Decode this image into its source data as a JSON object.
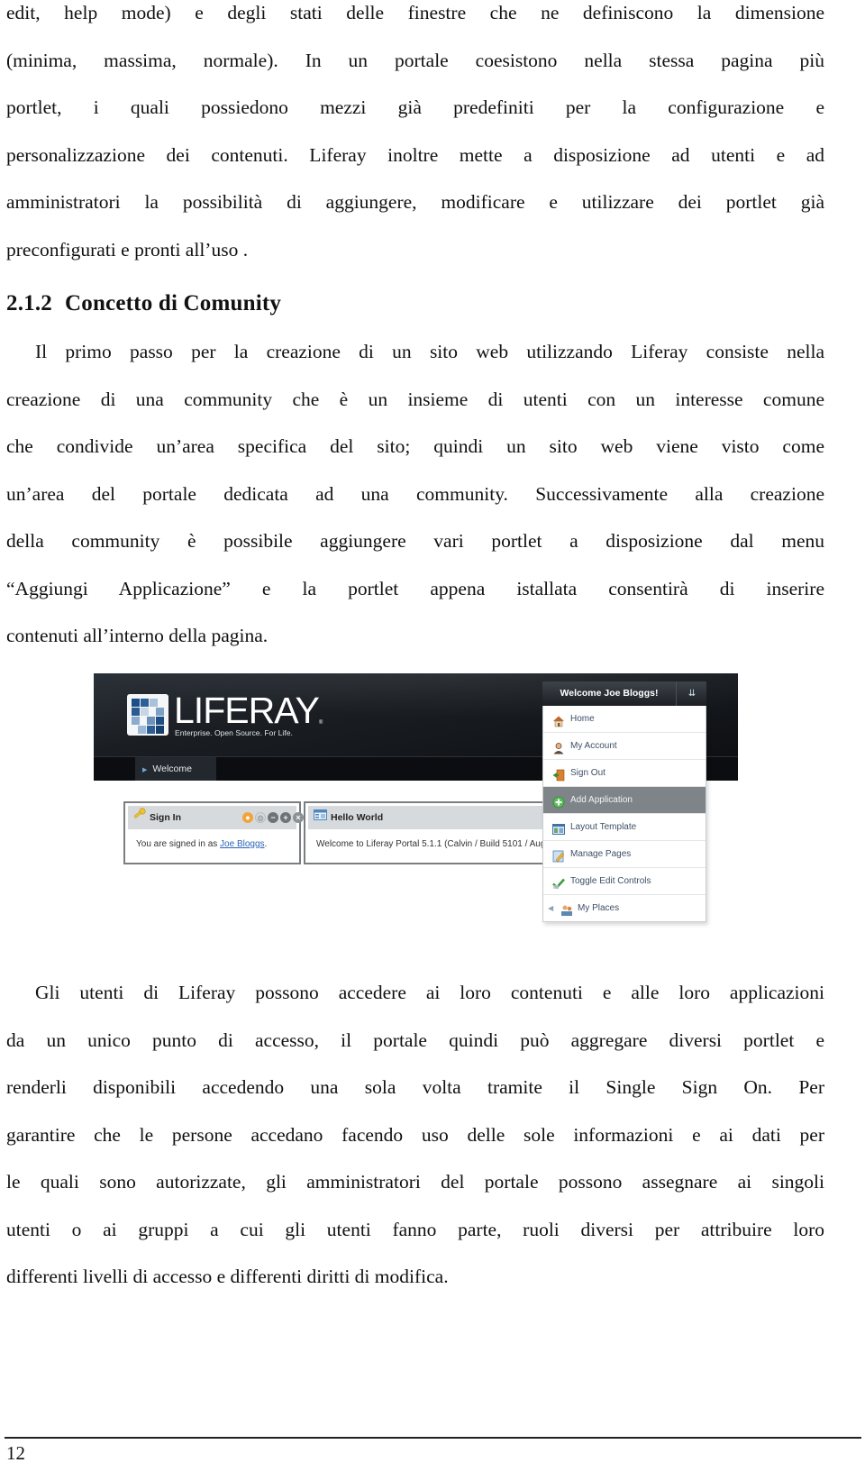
{
  "paragraph_1": {
    "lines": [
      "edit, help mode) e degli stati delle finestre che ne definiscono la dimensione",
      "(minima, massima, normale). In un portale coesistono nella stessa pagina più",
      "portlet, i quali possiedono mezzi già predefiniti per la configurazione e",
      "personalizzazione dei contenuti. Liferay inoltre mette a disposizione ad utenti e ad",
      "amministratori la possibilità di aggiungere, modificare e utilizzare dei portlet già",
      "preconfigurati e pronti all’uso ."
    ]
  },
  "section": {
    "number": "2.1.2",
    "title": "Concetto di Comunity"
  },
  "paragraph_2": {
    "lines": [
      "Il primo passo per la creazione di un sito web utilizzando Liferay consiste nella",
      "creazione di una community che è un insieme di utenti con un interesse comune",
      "che condivide un’area specifica del sito; quindi un sito web viene visto  come",
      "un’area del portale dedicata ad una community. Successivamente alla creazione",
      "della community è possibile aggiungere vari portlet a disposizione dal menu",
      "“Aggiungi Applicazione” e la portlet appena istallata consentirà di inserire",
      "contenuti all’interno della pagina."
    ]
  },
  "figure": {
    "logo": {
      "wordmark": "LIFERAY",
      "trademark": "®",
      "tagline": "Enterprise. Open Source. For Life."
    },
    "nav": {
      "current_page": "Welcome"
    },
    "dock": {
      "title": "Welcome Joe Bloggs!",
      "toggle_icon": "double-chevron-down-icon",
      "menu": [
        {
          "label": "Home",
          "icon": "home-icon",
          "active": false
        },
        {
          "label": "My Account",
          "icon": "user-icon",
          "active": false
        },
        {
          "label": "Sign Out",
          "icon": "sign-out-icon",
          "active": false
        },
        {
          "label": "Add Application",
          "icon": "add-icon",
          "active": true
        },
        {
          "label": "Layout Template",
          "icon": "layout-icon",
          "active": false
        },
        {
          "label": "Manage Pages",
          "icon": "pages-icon",
          "active": false
        },
        {
          "label": "Toggle Edit Controls",
          "icon": "checkmark-icon",
          "active": false
        },
        {
          "label": "My Places",
          "icon": "places-icon",
          "active": false
        }
      ],
      "active_color": "#7f8489"
    },
    "portlets": {
      "signin": {
        "title": "Sign In",
        "body_prefix": "You are signed in as ",
        "user_link": "Joe Bloggs",
        "body_suffix": ".",
        "controls": [
          "look-and-feel-icon",
          "configuration-icon",
          "minimize-icon",
          "maximize-icon",
          "close-icon"
        ]
      },
      "hello": {
        "title": "Hello World",
        "body": "Welcome to Liferay Portal 5.1.1 (Calvin / Build 5101 / Aug"
      }
    }
  },
  "paragraph_3": {
    "lines": [
      "Gli utenti  di Liferay possono accedere ai loro contenuti e alle loro applicazioni",
      "da un unico punto di accesso, il portale quindi può aggregare diversi portlet e",
      "renderli disponibili accedendo una sola volta tramite il Single Sign On. Per",
      "garantire che le persone accedano facendo uso delle sole informazioni e ai dati per",
      "le quali sono autorizzate, gli amministratori del portale possono assegnare ai singoli",
      "utenti o ai gruppi a cui gli utenti fanno parte, ruoli diversi per attribuire loro",
      "differenti livelli di accesso e differenti diritti di modifica."
    ]
  },
  "footer": {
    "page_number": "12"
  }
}
